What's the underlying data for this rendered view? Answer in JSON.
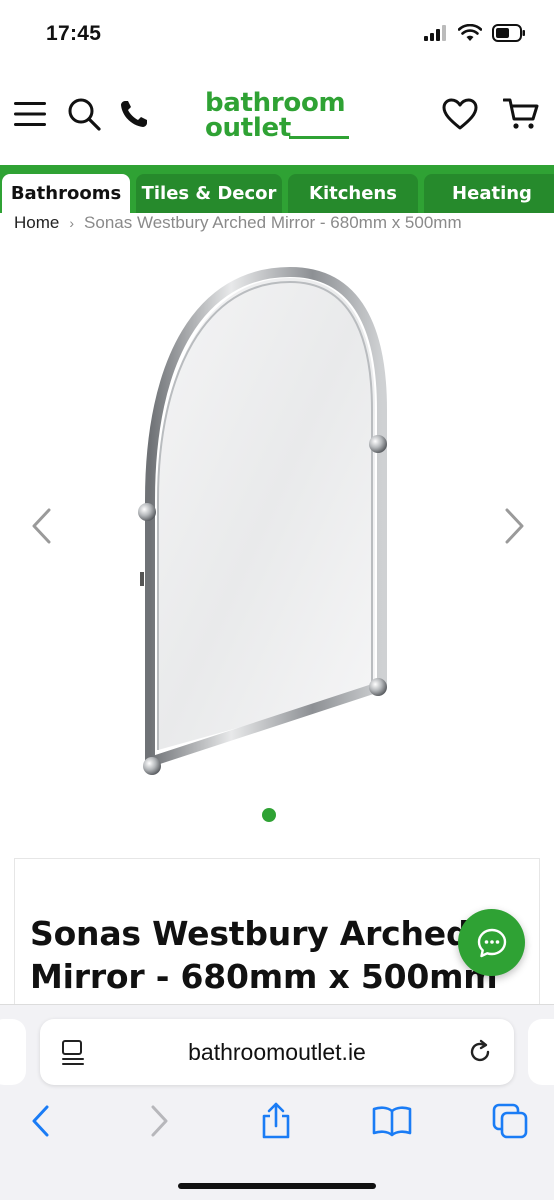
{
  "status_bar": {
    "time": "17:45"
  },
  "header": {
    "logo_line1": "bathroom",
    "logo_line2": "outlet",
    "brand_color": "#2fa234",
    "icons": [
      "menu-icon",
      "search-icon",
      "phone-icon",
      "heart-icon",
      "cart-icon"
    ]
  },
  "category_tabs": [
    {
      "label": "Bathrooms",
      "active": true
    },
    {
      "label": "Tiles & Decor",
      "active": false
    },
    {
      "label": "Kitchens",
      "active": false
    },
    {
      "label": "Heating",
      "active": false
    }
  ],
  "breadcrumb": {
    "home": "Home",
    "separator": "›",
    "current": "Sonas Westbury Arched Mirror - 680mm x 500mm"
  },
  "gallery": {
    "image_count": 1,
    "active_index": 0
  },
  "product": {
    "title": "Sonas Westbury Arched Mirror - 680mm x 500mm"
  },
  "browser": {
    "url": "bathroomoutlet.ie",
    "toolbar_icons": [
      "back-icon",
      "forward-icon",
      "share-icon",
      "bookmarks-icon",
      "tabs-icon"
    ]
  }
}
